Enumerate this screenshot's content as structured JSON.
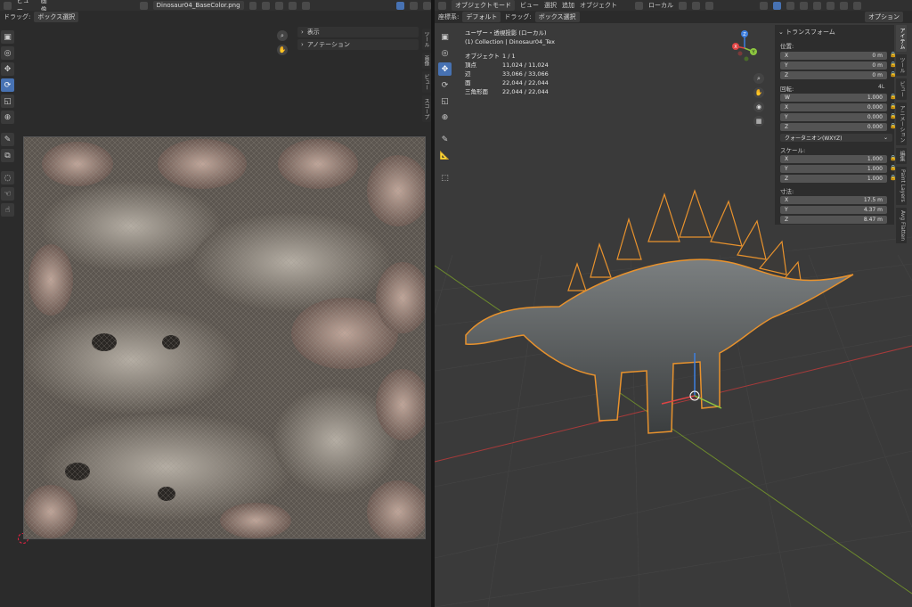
{
  "left_header": {
    "menu_view": "ビュー",
    "menu_image": "画像",
    "image_name": "Dinosaur04_BaseColor.png",
    "drag_label": "ドラッグ:",
    "drag_value": "ボックス選択"
  },
  "uv_overlays": {
    "display": "表示",
    "annotation": "アノテーション"
  },
  "left_sidetabs": [
    "ツール",
    "画像",
    "ビュー",
    "スコープ"
  ],
  "right_header": {
    "mode": "オブジェクトモード",
    "menu_view": "ビュー",
    "menu_select": "選択",
    "menu_add": "追加",
    "menu_object": "オブジェクト",
    "transform_orientation": "ローカル",
    "coord_label": "座標系:",
    "coord_value": "デフォルト",
    "drag_label": "ドラッグ:",
    "drag_value": "ボックス選択",
    "options": "オプション"
  },
  "viewport_info": {
    "view_name": "ユーザー・透視投影 (ローカル)",
    "collection": "(1) Collection | Dinosaur04_Tex",
    "stats": [
      {
        "label": "オブジェクト",
        "value": "1 / 1"
      },
      {
        "label": "頂点",
        "value": "11,024 / 11,024"
      },
      {
        "label": "辺",
        "value": "33,066 / 33,066"
      },
      {
        "label": "面",
        "value": "22,044 / 22,044"
      },
      {
        "label": "三角形面",
        "value": "22,044 / 22,044"
      }
    ]
  },
  "gizmo": {
    "z": "Z",
    "y": "Y",
    "x": "X"
  },
  "transform": {
    "title": "トランスフォーム",
    "location_label": "位置:",
    "location": [
      {
        "axis": "X",
        "value": "0 m"
      },
      {
        "axis": "Y",
        "value": "0 m"
      },
      {
        "axis": "Z",
        "value": "0 m"
      }
    ],
    "rotation_label": "回転:",
    "rotation_mode_badge": "4L",
    "rotation": [
      {
        "axis": "W",
        "value": "1.000"
      },
      {
        "axis": "X",
        "value": "0.000"
      },
      {
        "axis": "Y",
        "value": "0.000"
      },
      {
        "axis": "Z",
        "value": "0.000"
      }
    ],
    "rotation_mode": "クォータニオン(WXYZ)",
    "scale_label": "スケール:",
    "scale": [
      {
        "axis": "X",
        "value": "1.000"
      },
      {
        "axis": "Y",
        "value": "1.000"
      },
      {
        "axis": "Z",
        "value": "1.000"
      }
    ],
    "dimensions_label": "寸法:",
    "dimensions": [
      {
        "axis": "X",
        "value": "17.5 m"
      },
      {
        "axis": "Y",
        "value": "4.37 m"
      },
      {
        "axis": "Z",
        "value": "8.47 m"
      }
    ]
  },
  "right_sidetabs": [
    "アイテム",
    "ツール",
    "ビュー",
    "アニメーション",
    "編集",
    "Paint Layers",
    "Avg Flatten"
  ],
  "colors": {
    "accent": "#4772b3",
    "selection_outline": "#e8922d",
    "grid_x": "#a83a3a",
    "grid_y": "#6d8a2d"
  }
}
